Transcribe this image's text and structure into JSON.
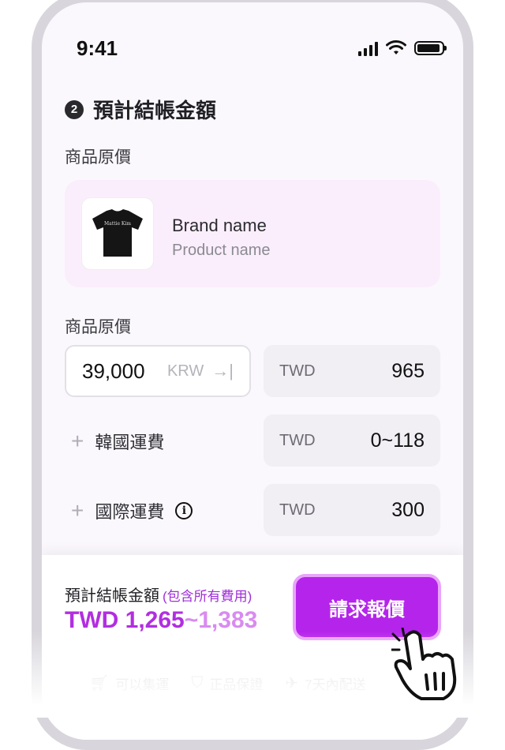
{
  "status_bar": {
    "time": "9:41"
  },
  "step": {
    "number": "2",
    "title": "預計結帳金額"
  },
  "product_section": {
    "label": "商品原價",
    "brand": "Brand name",
    "product": "Product name",
    "shirt_text": "Mattie Kim"
  },
  "price_section": {
    "label": "商品原價",
    "krw_value": "39,000",
    "krw_unit": "KRW",
    "converted": {
      "currency": "TWD",
      "value": "965"
    }
  },
  "fees": [
    {
      "label": "韓國運費",
      "currency": "TWD",
      "value": "0~118"
    },
    {
      "label": "國際運費",
      "currency": "TWD",
      "value": "300"
    }
  ],
  "summary": {
    "label": "預計結帳金額",
    "note": "(包含所有費用)",
    "amount_prefix": "TWD 1,265",
    "amount_range": "~1,383",
    "button": "請求報價"
  },
  "features": [
    {
      "icon": "cart-icon",
      "label": "可以集運"
    },
    {
      "icon": "shield-icon",
      "label": "正品保證"
    },
    {
      "icon": "plane-icon",
      "label": "7天內配送"
    }
  ],
  "colors": {
    "accent": "#b524eb",
    "accent_light": "#e9a4fb",
    "card_bg": "#fbeefc"
  }
}
